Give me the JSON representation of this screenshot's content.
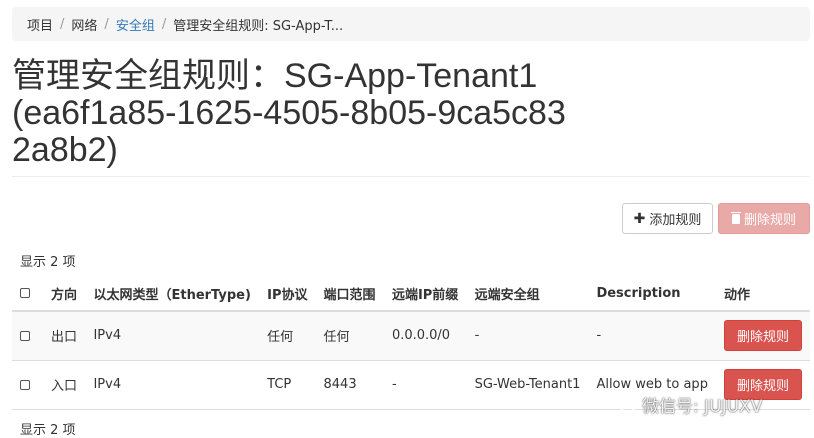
{
  "breadcrumb": {
    "items": [
      "项目",
      "网络",
      "安全组",
      "管理安全组规则: SG-App-T..."
    ],
    "separator": "/"
  },
  "page_title": "管理安全组规则：SG-App-Tenant1 (ea6f1a85-1625-4505-8b05-9ca5c832a8b2)",
  "actions": {
    "add_rule": "添加规则",
    "delete_rules": "删除规则"
  },
  "count_text": "显示 2 项",
  "table": {
    "headers": [
      "方向",
      "以太网类型（EtherType)",
      "IP协议",
      "端口范围",
      "远端IP前缀",
      "远端安全组",
      "Description",
      "动作"
    ],
    "rows": [
      {
        "direction": "出口",
        "ethertype": "IPv4",
        "protocol": "任何",
        "port_range": "任何",
        "remote_ip": "0.0.0.0/0",
        "remote_group": "-",
        "description": "-",
        "action": "删除规则"
      },
      {
        "direction": "入口",
        "ethertype": "IPv4",
        "protocol": "TCP",
        "port_range": "8443",
        "remote_ip": "-",
        "remote_group": "SG-Web-Tenant1",
        "description": "Allow web to app",
        "action": "删除规则"
      }
    ]
  },
  "watermark": {
    "text": "微信号: JUJUXV",
    "icon": "wechat-icon"
  },
  "colors": {
    "link": "#337ab7",
    "danger": "#d9534f",
    "danger_disabled": "#e8a9a7"
  }
}
